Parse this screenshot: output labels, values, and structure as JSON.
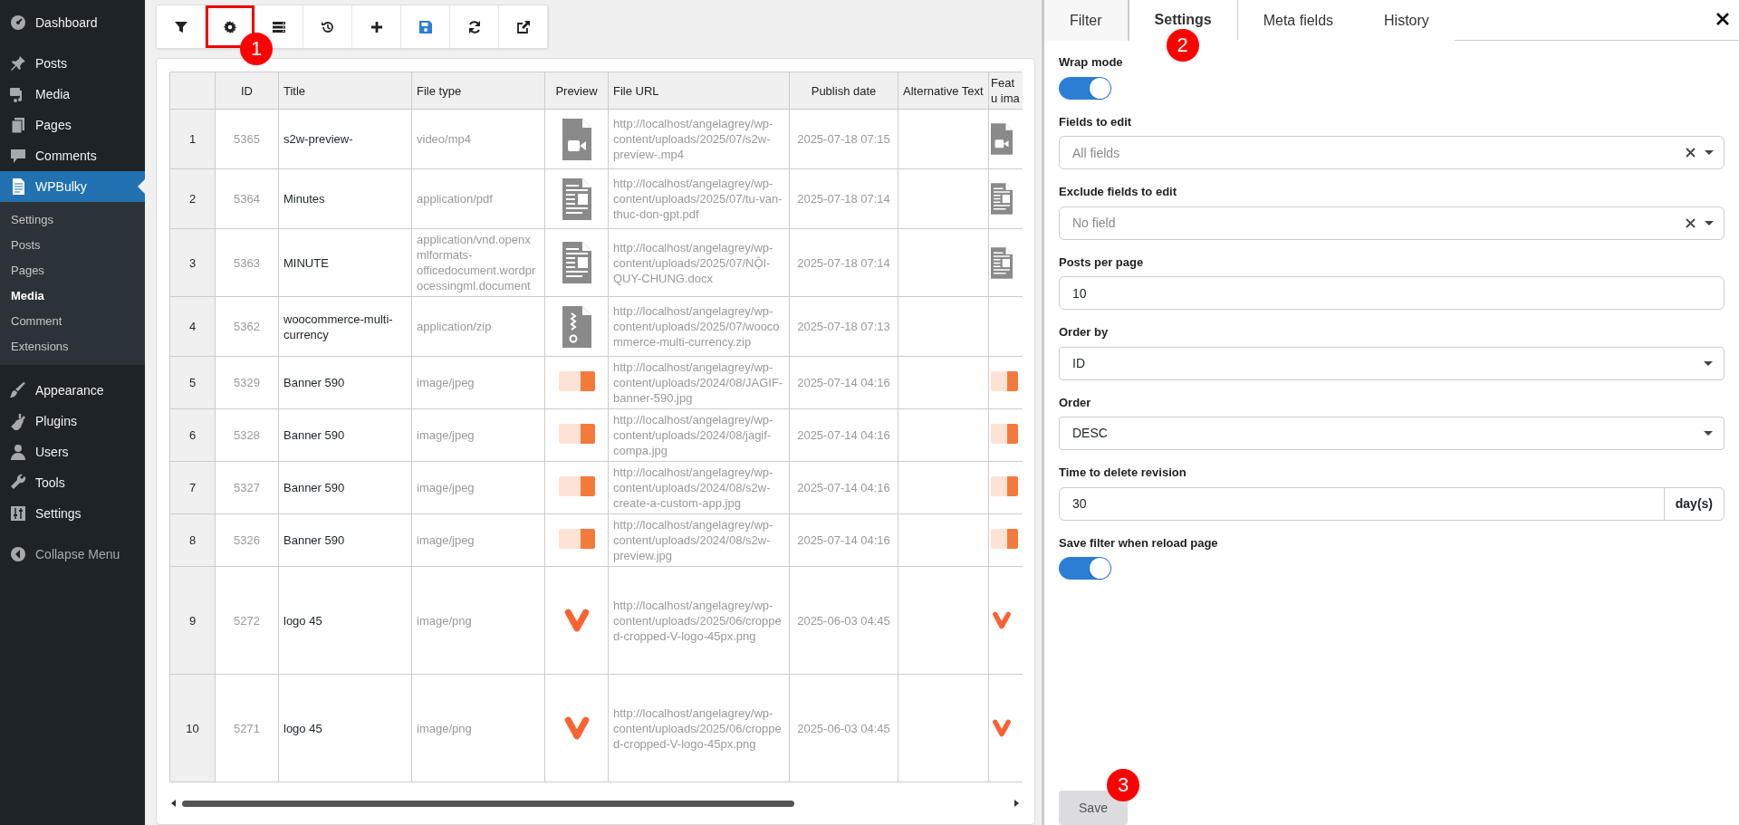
{
  "menu": [
    {
      "label": "Dashboard",
      "selected": false
    },
    {
      "label": "Posts",
      "selected": false
    },
    {
      "label": "Media",
      "selected": false
    },
    {
      "label": "Pages",
      "selected": false
    },
    {
      "label": "Comments",
      "selected": false
    },
    {
      "label": "WPBulky",
      "selected": true,
      "children": [
        {
          "label": "Settings",
          "selected": false
        },
        {
          "label": "Posts",
          "selected": false
        },
        {
          "label": "Pages",
          "selected": false
        },
        {
          "label": "Media",
          "selected": true
        },
        {
          "label": "Comment",
          "selected": false
        },
        {
          "label": "Extensions",
          "selected": false
        }
      ]
    },
    {
      "label": "Appearance",
      "selected": false
    },
    {
      "label": "Plugins",
      "selected": false
    },
    {
      "label": "Users",
      "selected": false
    },
    {
      "label": "Tools",
      "selected": false
    },
    {
      "label": "Settings",
      "selected": false
    },
    {
      "label": "Collapse Menu",
      "selected": false
    }
  ],
  "toolbar": [
    {
      "kind": "filter",
      "highlighted": false
    },
    {
      "kind": "settings",
      "highlighted": true,
      "callout": "1"
    },
    {
      "kind": "columns",
      "highlighted": false
    },
    {
      "kind": "history",
      "highlighted": false
    },
    {
      "kind": "add",
      "highlighted": false
    },
    {
      "kind": "save",
      "highlighted": false
    },
    {
      "kind": "reload",
      "highlighted": false
    },
    {
      "kind": "external",
      "highlighted": false
    }
  ],
  "table": {
    "columns": [
      "",
      "ID",
      "Title",
      "File type",
      "Preview",
      "File URL",
      "Publish date",
      "Alternative Text",
      "Featu ima"
    ],
    "rows": [
      {
        "number": "1",
        "id": "5365",
        "title": "s2w-preview-",
        "file_type": "video/mp4",
        "kind": "video",
        "url": "http://localhost/angelagrey/wp-content/uploads/2025/07/s2w-preview-.mp4",
        "date": "2025-07-18 07:15",
        "has_featured_image": true
      },
      {
        "number": "2",
        "id": "5364",
        "title": "Minutes",
        "file_type": "application/pdf",
        "kind": "document",
        "url": "http://localhost/angelagrey/wp-content/uploads/2025/07/tu-van-thuc-don-gpt.pdf",
        "date": "2025-07-18 07:14",
        "has_featured_image": true
      },
      {
        "number": "3",
        "id": "5363",
        "title": "MINUTE",
        "file_type": "application/vnd.openxmlformats-officedocument.wordprocessingml.document",
        "kind": "document",
        "url": "http://localhost/angelagrey/wp-content/uploads/2025/07/NỘI-QUY-CHUNG.docx",
        "date": "2025-07-18 07:14",
        "has_featured_image": true
      },
      {
        "number": "4",
        "id": "5362",
        "title": "woocommerce-multi-currency",
        "file_type": "application/zip",
        "kind": "zip",
        "url": "http://localhost/angelagrey/wp-content/uploads/2025/07/woocommerce-multi-currency.zip",
        "date": "2025-07-18 07:13",
        "has_featured_image": false
      },
      {
        "number": "5",
        "id": "5329",
        "title": "Banner 590",
        "file_type": "image/jpeg",
        "kind": "image",
        "url": "http://localhost/angelagrey/wp-content/uploads/2024/08/JAGIF-banner-590.jpg",
        "date": "2025-07-14 04:16",
        "has_featured_image": true
      },
      {
        "number": "6",
        "id": "5328",
        "title": "Banner 590",
        "file_type": "image/jpeg",
        "kind": "image",
        "url": "http://localhost/angelagrey/wp-content/uploads/2024/08/jagif-compa.jpg",
        "date": "2025-07-14 04:16",
        "has_featured_image": true
      },
      {
        "number": "7",
        "id": "5327",
        "title": "Banner 590",
        "file_type": "image/jpeg",
        "kind": "image",
        "url": "http://localhost/angelagrey/wp-content/uploads/2024/08/s2w-create-a-custom-app.jpg",
        "date": "2025-07-14 04:16",
        "has_featured_image": true
      },
      {
        "number": "8",
        "id": "5326",
        "title": "Banner 590",
        "file_type": "image/jpeg",
        "kind": "image",
        "url": "http://localhost/angelagrey/wp-content/uploads/2024/08/s2w-preview.jpg",
        "date": "2025-07-14 04:16",
        "has_featured_image": true
      },
      {
        "number": "9",
        "id": "5272",
        "title": "logo 45",
        "file_type": "image/png",
        "kind": "logo",
        "url": "http://localhost/angelagrey/wp-content/uploads/2025/06/cropped-cropped-V-logo-45px.png",
        "date": "2025-06-03 04:45",
        "has_featured_image": true
      },
      {
        "number": "10",
        "id": "5271",
        "title": "logo 45",
        "file_type": "image/png",
        "kind": "logo",
        "url": "http://localhost/angelagrey/wp-content/uploads/2025/06/cropped-cropped-V-logo-45px.png",
        "date": "2025-06-03 04:45",
        "has_featured_image": true
      }
    ]
  },
  "panel": {
    "tabs": [
      {
        "label": "Filter",
        "selected": false
      },
      {
        "label": "Settings",
        "selected": true,
        "callout": "2"
      },
      {
        "label": "Meta fields",
        "selected": false
      },
      {
        "label": "History",
        "selected": false
      }
    ],
    "settings": [
      {
        "kind": "toggle",
        "label": "Wrap mode",
        "on": true
      },
      {
        "kind": "multiselect",
        "label": "Fields to edit",
        "placeholder": "All fields"
      },
      {
        "kind": "multiselect",
        "label": "Exclude fields to edit",
        "placeholder": "No field"
      },
      {
        "kind": "input",
        "label": "Posts per page",
        "value": "10"
      },
      {
        "kind": "select",
        "label": "Order by",
        "value": "ID"
      },
      {
        "kind": "select",
        "label": "Order",
        "value": "DESC"
      },
      {
        "kind": "input",
        "label": "Time to delete revision",
        "value": "30",
        "addon": "day(s)"
      },
      {
        "kind": "toggle",
        "label": "Save filter when reload page",
        "on": true
      }
    ],
    "save_button": {
      "label": "Save",
      "callout": "3"
    }
  }
}
